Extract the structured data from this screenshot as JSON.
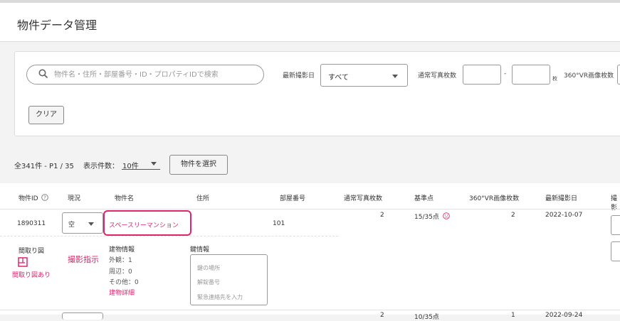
{
  "page": {
    "title": "物件データ管理"
  },
  "filters": {
    "search_placeholder": "物件名・住所・部屋番号・ID・プロパティIDで検索",
    "latest_shoot_label": "最新撮影日",
    "latest_shoot_value": "すべて",
    "photo_count_label": "通常写真枚数",
    "range_dash": "-",
    "unit": "枚",
    "vr_count_label": "360°VR画像枚数",
    "clear_label": "クリア"
  },
  "summary": {
    "total": "全341件 - P1 / 35",
    "per_page_label": "表示件数：",
    "per_page_value": "10件",
    "select_button": "物件を選択"
  },
  "table": {
    "headers": [
      "物件ID",
      "現況",
      "物件名",
      "住所",
      "部屋番号",
      "通常写真枚数",
      "基準点",
      "360°VR画像枚数",
      "最新撮影日",
      "撮影"
    ],
    "row": {
      "id": "1890311",
      "status": "空",
      "name": "スペースリーマンション",
      "address": "",
      "room": "101",
      "photo_count": "2",
      "base_point": "15/35点",
      "vr_count": "2",
      "latest_date": "2022-10-07",
      "floorplan_label": "間取り図",
      "floorplan_status": "間取り図あり",
      "shoot_instruction": "撮影指示",
      "building_info_title": "建物情報",
      "building_info": [
        "外観：1",
        "周辺：0",
        "その他：0"
      ],
      "building_detail_link": "建物詳細",
      "key_info_title": "鍵情報",
      "key_placeholders": [
        "鍵の場所",
        "解錠番号",
        "緊急連絡先を入力"
      ]
    },
    "next_row": {
      "photo_count": "2",
      "base_point": "10/35点",
      "vr_count": "1",
      "latest_date": "2022-09-24"
    }
  },
  "colors": {
    "accent": "#e0246e"
  }
}
